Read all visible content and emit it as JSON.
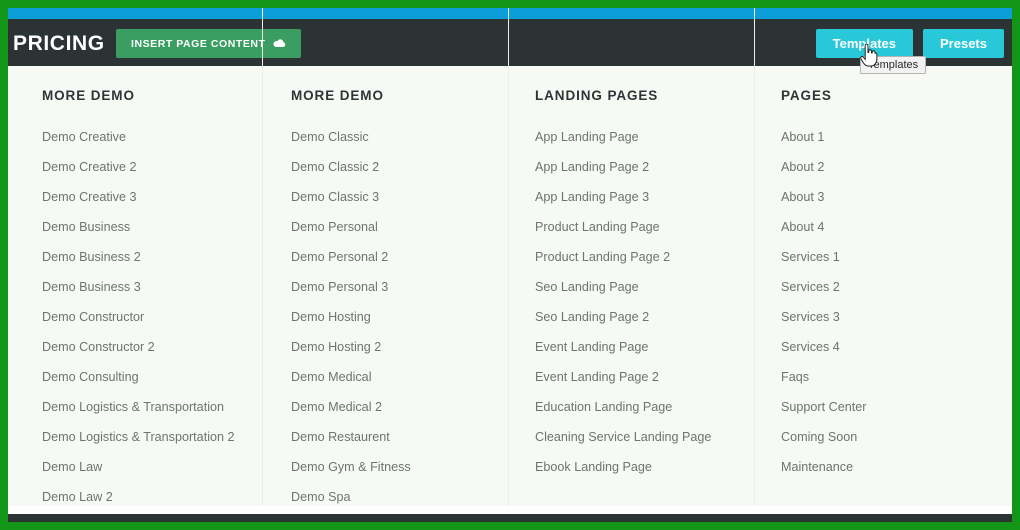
{
  "window": {
    "frame_color": "#119618",
    "accent_bar_color": "#0b9ed9",
    "header_bg_color": "#2b3334",
    "panel_bg_color": "#f7f9f5"
  },
  "header": {
    "title": "PRICING",
    "insert_button": {
      "label": "INSERT PAGE CONTENT",
      "icon": "cloud-icon",
      "color": "#3a9e62"
    },
    "actions": [
      {
        "label": "Templates",
        "color": "#28c8d8",
        "active": true
      },
      {
        "label": "Presets",
        "color": "#28c8d8",
        "active": false
      }
    ]
  },
  "tooltip": {
    "text": "Templates"
  },
  "cursor": {
    "type": "pointer-hand"
  },
  "columns": [
    {
      "title": "MORE DEMO",
      "items": [
        "Demo Creative",
        "Demo Creative 2",
        "Demo Creative 3",
        "Demo Business",
        "Demo Business 2",
        "Demo Business 3",
        "Demo Constructor",
        "Demo Constructor 2",
        "Demo Consulting",
        "Demo Logistics & Transportation",
        "Demo Logistics & Transportation 2",
        "Demo Law",
        "Demo Law 2"
      ]
    },
    {
      "title": "MORE DEMO",
      "items": [
        "Demo Classic",
        "Demo Classic 2",
        "Demo Classic 3",
        "Demo Personal",
        "Demo Personal 2",
        "Demo Personal 3",
        "Demo Hosting",
        "Demo Hosting 2",
        "Demo Medical",
        "Demo Medical 2",
        "Demo Restaurent",
        "Demo Gym & Fitness",
        "Demo Spa"
      ]
    },
    {
      "title": "LANDING PAGES",
      "items": [
        "App Landing Page",
        "App Landing Page 2",
        "App Landing Page 3",
        "Product Landing Page",
        "Product Landing Page 2",
        "Seo Landing Page",
        "Seo Landing Page 2",
        "Event Landing Page",
        "Event Landing Page 2",
        "Education Landing Page",
        "Cleaning Service Landing Page",
        "Ebook Landing Page"
      ]
    },
    {
      "title": "PAGES",
      "items": [
        "About 1",
        "About 2",
        "About 3",
        "About 4",
        "Services 1",
        "Services 2",
        "Services 3",
        "Services 4",
        "Faqs",
        "Support Center",
        "Coming Soon",
        "Maintenance"
      ]
    }
  ]
}
